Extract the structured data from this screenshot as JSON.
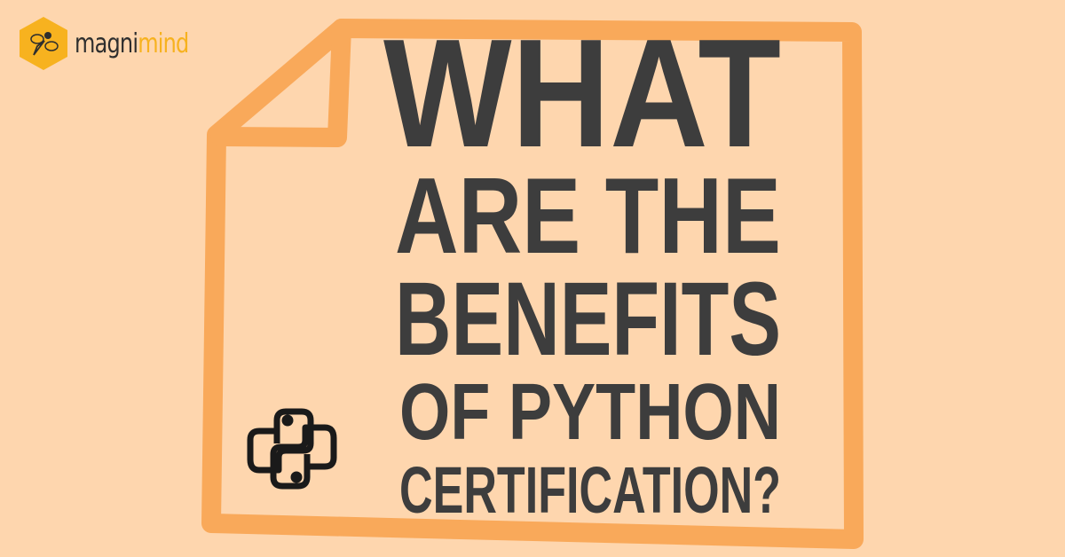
{
  "logo": {
    "part1": "magni",
    "part2": "mind",
    "icon": "bee-hexagon-icon"
  },
  "headline": [
    "WHAT",
    "ARE THE",
    "BENEFITS",
    "OF PYTHON",
    "CERTIFICATION?"
  ],
  "colors": {
    "background": "#fed6ae",
    "frame": "#f9a95a",
    "text": "#3d3d3d",
    "brand": "#f7b21f"
  },
  "icons": [
    "document-frame-icon",
    "python-logo-icon"
  ]
}
